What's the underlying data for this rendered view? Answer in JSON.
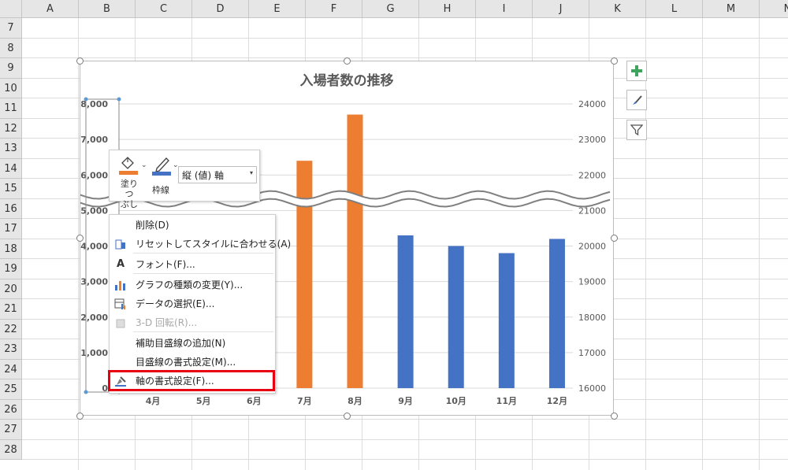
{
  "spreadsheet": {
    "columns": [
      "A",
      "B",
      "C",
      "D",
      "E",
      "F",
      "G",
      "H",
      "I",
      "J",
      "K",
      "L",
      "M",
      "N"
    ],
    "rows": [
      "7",
      "8",
      "9",
      "10",
      "11",
      "12",
      "13",
      "14",
      "15",
      "16",
      "17",
      "18",
      "19",
      "20",
      "21",
      "22",
      "23",
      "24",
      "25",
      "26",
      "27",
      "28"
    ]
  },
  "chart_data": {
    "type": "bar",
    "title": "入場者数の推移",
    "categories": [
      "4月",
      "5月",
      "6月",
      "7月",
      "8月",
      "9月",
      "10月",
      "11月",
      "12月"
    ],
    "left_axis_ticks": [
      "0",
      "1,000",
      "2,000",
      "3,000",
      "4,000",
      "5,000",
      "6,000",
      "7,000",
      "8,000"
    ],
    "right_axis_ticks": [
      "16000",
      "17000",
      "18000",
      "19000",
      "20000",
      "21000",
      "22000",
      "23000",
      "24000"
    ],
    "visible_bars": [
      {
        "category": "7月",
        "value": 6400,
        "color": "#ed7d31",
        "axis": "left"
      },
      {
        "category": "8月",
        "value": 7700,
        "color": "#ed7d31",
        "axis": "left"
      },
      {
        "category": "9月",
        "value": 20300,
        "color": "#4472c4",
        "axis": "right"
      },
      {
        "category": "10月",
        "value": 20000,
        "color": "#4472c4",
        "axis": "right"
      },
      {
        "category": "11月",
        "value": 19800,
        "color": "#4472c4",
        "axis": "right"
      },
      {
        "category": "12月",
        "value": 20200,
        "color": "#4472c4",
        "axis": "right"
      }
    ],
    "ylim_left": [
      0,
      8000
    ],
    "ylim_right": [
      16000,
      24000
    ],
    "grid": true,
    "axis_break": "wavy line near 6,000 / 21500"
  },
  "side_buttons": [
    "plus-icon",
    "brush-icon",
    "filter-icon"
  ],
  "mini_toolbar": {
    "fill_label_1": "塗りつ",
    "fill_label_2": "ぶし",
    "outline_label": "枠線",
    "selector_value": "縦 (値) 軸"
  },
  "context_menu": {
    "items": [
      {
        "label": "削除(D)",
        "icon": "",
        "disabled": false
      },
      {
        "label": "リセットしてスタイルに合わせる(A)",
        "icon": "reset-style-icon",
        "disabled": false
      },
      {
        "label": "フォント(F)...",
        "icon": "font-icon",
        "disabled": false
      },
      {
        "label": "グラフの種類の変更(Y)...",
        "icon": "chart-type-icon",
        "disabled": false
      },
      {
        "label": "データの選択(E)...",
        "icon": "select-data-icon",
        "disabled": false
      },
      {
        "label": "3-D 回転(R)...",
        "icon": "rotate-3d-icon",
        "disabled": true
      },
      {
        "label": "補助目盛線の追加(N)",
        "icon": "",
        "disabled": false
      },
      {
        "label": "目盛線の書式設定(M)...",
        "icon": "",
        "disabled": false
      },
      {
        "label": "軸の書式設定(F)...",
        "icon": "format-axis-icon",
        "disabled": false
      }
    ]
  },
  "colors": {
    "orange": "#ed7d31",
    "blue": "#4472c4",
    "highlight": "#e60012"
  }
}
